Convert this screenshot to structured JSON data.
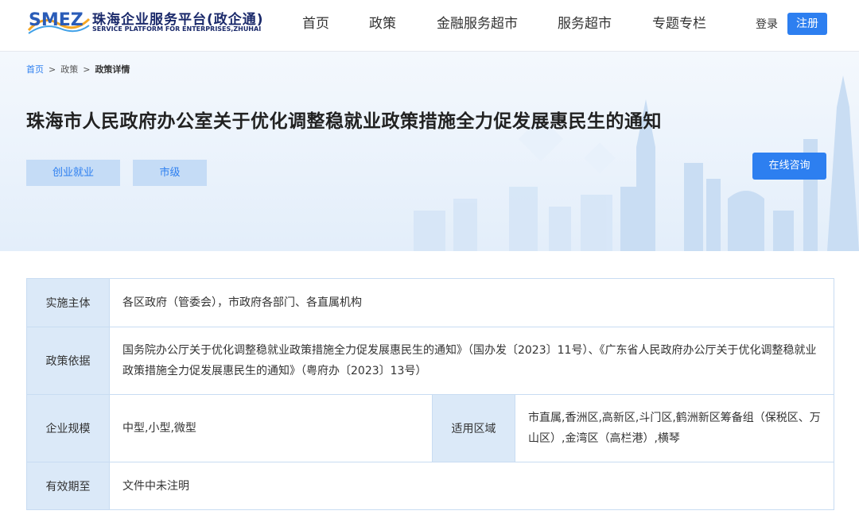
{
  "header": {
    "logo_text": "SMEZ",
    "logo_cn": "珠海企业服务平台(政企通)",
    "logo_en": "SERVICE PLATFORM FOR ENTERPRISES,ZHUHAI",
    "nav": [
      "首页",
      "政策",
      "金融服务超市",
      "服务超市",
      "专题专栏"
    ],
    "login": "登录",
    "register": "注册",
    "accent": "#2d7ff0"
  },
  "breadcrumb": {
    "home": "首页",
    "sep": ">",
    "section": "政策",
    "current": "政策详情"
  },
  "policy": {
    "title": "珠海市人民政府办公室关于优化调整稳就业政策措施全力促发展惠民生的通知",
    "tags": [
      "创业就业",
      "市级"
    ],
    "consult_button": "在线咨询"
  },
  "details": {
    "implementer_label": "实施主体",
    "implementer": "各区政府（管委会），市政府各部门、各直属机构",
    "basis_label": "政策依据",
    "basis": "国务院办公厅关于优化调整稳就业政策措施全力促发展惠民生的通知》（国办发〔2023〕11号）、《广东省人民政府办公厅关于优化调整稳就业政策措施全力促发展惠民生的通知》（粤府办〔2023〕13号）",
    "scale_label": "企业规模",
    "scale": "中型,小型,微型",
    "region_label": "适用区域",
    "region": "市直属,香洲区,高新区,斗门区,鹤洲新区筹备组（保税区、万山区）,金湾区（高栏港）,横琴",
    "validity_label": "有效期至",
    "validity": "文件中未注明"
  }
}
